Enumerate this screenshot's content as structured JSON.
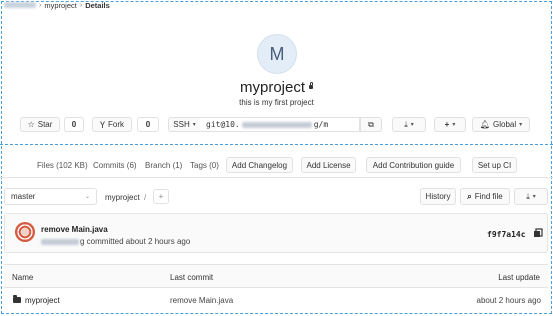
{
  "breadcrumb": {
    "project": "myproject",
    "current": "Details"
  },
  "project": {
    "avatar_letter": "M",
    "name": "myproject",
    "description": "this is my first project",
    "visibility_icon": "lock-icon"
  },
  "actions": {
    "star_label": "Star",
    "star_count": "0",
    "fork_label": "Fork",
    "fork_count": "0",
    "protocol_label": "SSH",
    "clone_url_start": "git@10.",
    "clone_url_end": "g/m",
    "global_label": "Global"
  },
  "stats": {
    "files": "Files (102 KB)",
    "commits": "Commits (6)",
    "branch": "Branch (1)",
    "tags": "Tags (0)",
    "add_changelog": "Add Changelog",
    "add_license": "Add License",
    "add_contribution": "Add Contribution guide",
    "setup_ci": "Set up CI"
  },
  "repo_nav": {
    "branch": "master",
    "path": "myproject",
    "path_sep": "/",
    "history_label": "History",
    "find_file_label": "Find file"
  },
  "last_commit": {
    "title": "remove Main.java",
    "meta_suffix": "g committed about 2 hours ago",
    "sha": "f9f7a14c"
  },
  "table": {
    "headers": [
      "Name",
      "Last commit",
      "Last update"
    ],
    "rows": [
      {
        "name": "myproject",
        "last_commit": "remove Main.java",
        "last_update": "about 2 hours ago"
      }
    ]
  },
  "colors": {
    "accent_dashed": "#4a9fd8",
    "avatar_bg": "#e3edf8",
    "avatar_text": "#495f79"
  }
}
